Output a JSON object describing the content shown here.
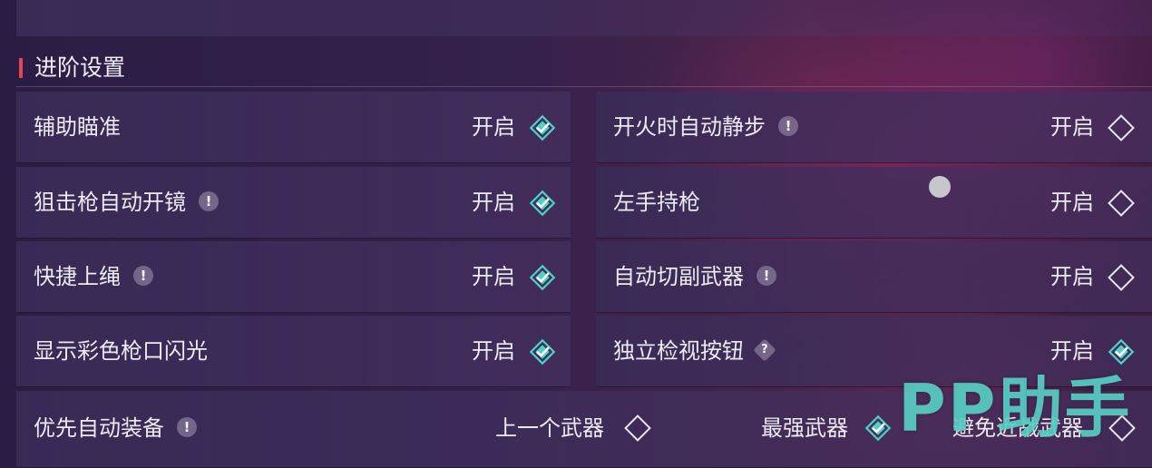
{
  "section_title": "进阶设置",
  "on_label": "开启",
  "colors": {
    "accent": "#e5455c",
    "checked": "#4fd1c5",
    "unchecked": "#e8e6ee"
  },
  "settings_left": [
    {
      "label": "辅助瞄准",
      "value": "开启",
      "has_info": false,
      "checked": true
    },
    {
      "label": "狙击枪自动开镜",
      "value": "开启",
      "has_info": true,
      "checked": true
    },
    {
      "label": "快捷上绳",
      "value": "开启",
      "has_info": true,
      "checked": true
    },
    {
      "label": "显示彩色枪口闪光",
      "value": "开启",
      "has_info": false,
      "checked": true
    }
  ],
  "settings_right": [
    {
      "label": "开火时自动静步",
      "value": "开启",
      "has_info": true,
      "checked": false
    },
    {
      "label": "左手持枪",
      "value": "开启",
      "has_info": false,
      "checked": false
    },
    {
      "label": "自动切副武器",
      "value": "开启",
      "has_info": true,
      "checked": false
    },
    {
      "label": "独立检视按钮",
      "value": "开启",
      "has_info": true,
      "info_symbol": "?",
      "checked": true
    }
  ],
  "priority_equip": {
    "label": "优先自动装备",
    "options": [
      {
        "label": "上一个武器",
        "checked": false
      },
      {
        "label": "最强武器",
        "checked": true
      },
      {
        "label": "避免近战武器",
        "checked": false
      }
    ]
  },
  "info_icon_text": "!",
  "question_icon_text": "?",
  "watermark": "PP助手"
}
